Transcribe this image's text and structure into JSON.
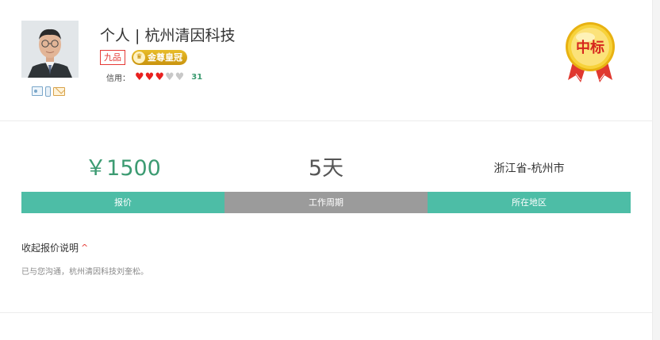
{
  "bidder": {
    "name": "个人 | 杭州清因科技",
    "rank_badge": "九品",
    "crown_badge": "金尊皇冠",
    "credit_label": "信用：",
    "credit_hearts_filled": 3,
    "credit_hearts_total": 5,
    "credit_score": "31"
  },
  "medal": {
    "label": "中标",
    "colors": {
      "gold": "#f2c21a",
      "ribbon": "#e0382f"
    }
  },
  "stats": {
    "price_value": "￥1500",
    "period_value": "5天",
    "area_value": "浙江省-杭州市",
    "price_label": "报价",
    "period_label": "工作周期",
    "area_label": "所在地区"
  },
  "details": {
    "toggle_label": "收起报价说明",
    "toggle_caret": "^",
    "note": "已与您沟通，杭州清因科技刘奎松。"
  },
  "colors": {
    "accent_green": "#4dbda6",
    "price_green": "#3c9b72",
    "gray_bar": "#9b9b9b",
    "badge_red": "#e53935"
  }
}
